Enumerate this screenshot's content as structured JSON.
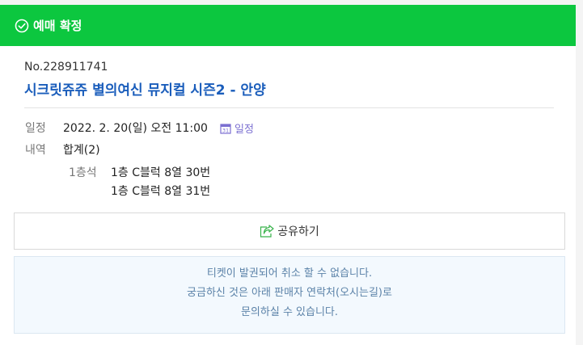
{
  "header": {
    "title": "예매 확정",
    "icon": "check-circle-icon",
    "color": "#0cc73f"
  },
  "booking": {
    "order_no": "No.228911741",
    "title": "시크릿쥬쥬 별의여신 뮤지컬 시즌2 - 안양",
    "date_label": "일정",
    "date_value": "2022. 2. 20(일) 오전 11:00",
    "calendar_link": "일정",
    "detail_label": "내역",
    "detail_value": "합계(2)",
    "seat_grade": "1층석",
    "seats": [
      "1층 C블럭 8열 30번",
      "1층 C블럭 8열 31번"
    ]
  },
  "share_button": {
    "label": "공유하기",
    "icon": "share-icon"
  },
  "notice": {
    "lines": [
      "티켓이 발권되어 취소 할 수 없습니다.",
      "궁금하신 것은 아래 판매자 연락처(오시는길)로",
      "문의하실 수 있습니다."
    ]
  }
}
